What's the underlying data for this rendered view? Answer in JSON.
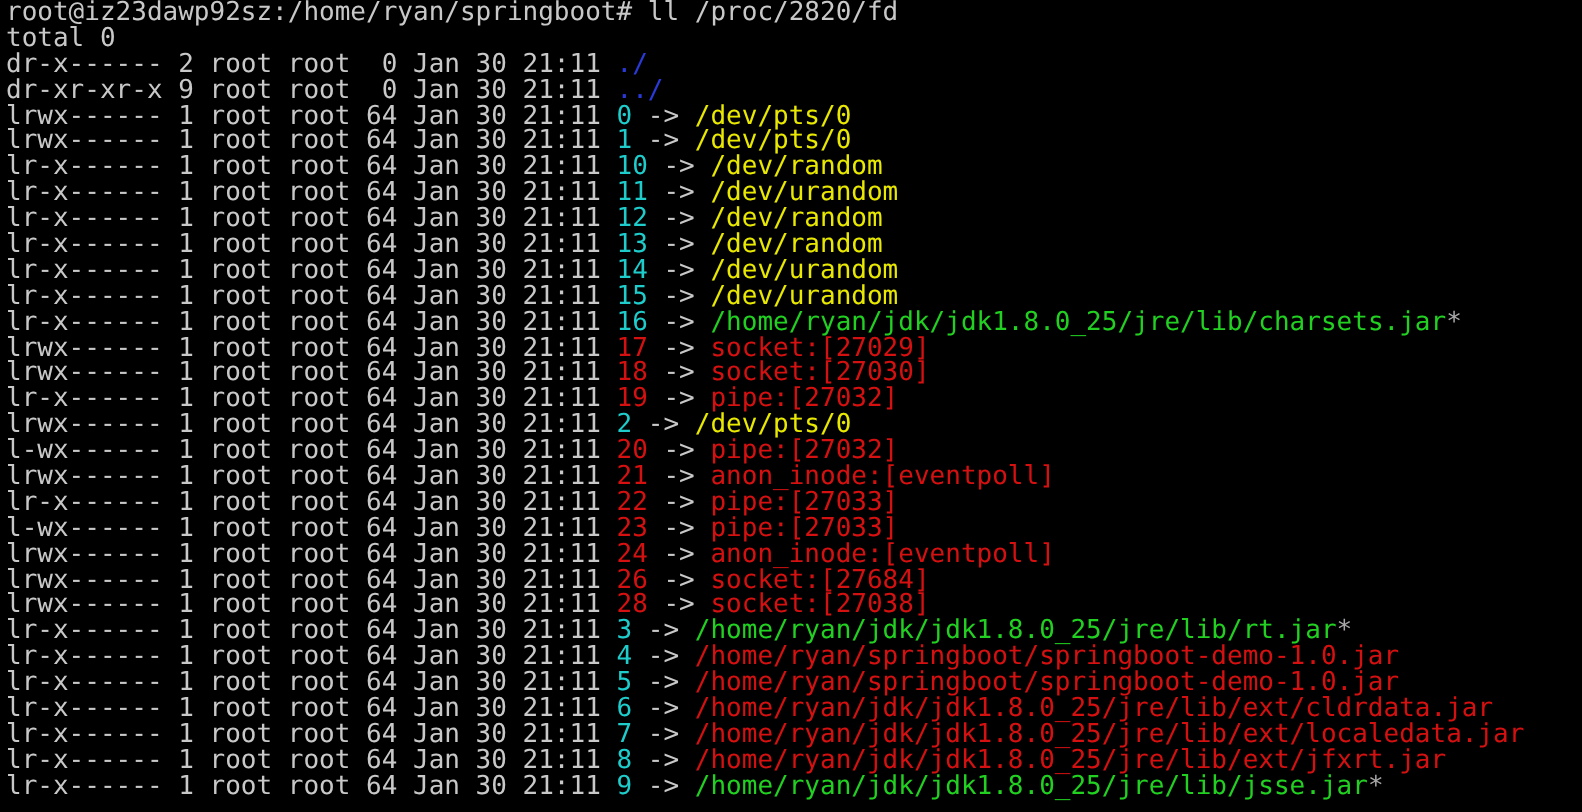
{
  "prompt": {
    "text": "root@iz23dawp92sz:/home/ryan/springboot#",
    "command": "ll /proc/2820/fd"
  },
  "total": "total 0",
  "entries": [
    {
      "meta": "dr-x------ 2 root root  0 Jan 30 21:11",
      "name": {
        "text": "./",
        "color": "#2a3ad8"
      }
    },
    {
      "meta": "dr-xr-xr-x 9 root root  0 Jan 30 21:11",
      "name": {
        "text": "../",
        "color": "#2a3ad8"
      }
    },
    {
      "meta": "lrwx------ 1 root root 64 Jan 30 21:11",
      "name": {
        "text": "0",
        "color": "#1ecccc"
      },
      "arrow": "->",
      "target": {
        "text": "/dev/pts/0",
        "color": "#e8e800"
      }
    },
    {
      "meta": "lrwx------ 1 root root 64 Jan 30 21:11",
      "name": {
        "text": "1",
        "color": "#1ecccc"
      },
      "arrow": "->",
      "target": {
        "text": "/dev/pts/0",
        "color": "#e8e800"
      }
    },
    {
      "meta": "lr-x------ 1 root root 64 Jan 30 21:11",
      "name": {
        "text": "10",
        "color": "#1ecccc"
      },
      "arrow": "->",
      "target": {
        "text": "/dev/random",
        "color": "#e8e800"
      }
    },
    {
      "meta": "lr-x------ 1 root root 64 Jan 30 21:11",
      "name": {
        "text": "11",
        "color": "#1ecccc"
      },
      "arrow": "->",
      "target": {
        "text": "/dev/urandom",
        "color": "#e8e800"
      }
    },
    {
      "meta": "lr-x------ 1 root root 64 Jan 30 21:11",
      "name": {
        "text": "12",
        "color": "#1ecccc"
      },
      "arrow": "->",
      "target": {
        "text": "/dev/random",
        "color": "#e8e800"
      }
    },
    {
      "meta": "lr-x------ 1 root root 64 Jan 30 21:11",
      "name": {
        "text": "13",
        "color": "#1ecccc"
      },
      "arrow": "->",
      "target": {
        "text": "/dev/random",
        "color": "#e8e800"
      }
    },
    {
      "meta": "lr-x------ 1 root root 64 Jan 30 21:11",
      "name": {
        "text": "14",
        "color": "#1ecccc"
      },
      "arrow": "->",
      "target": {
        "text": "/dev/urandom",
        "color": "#e8e800"
      }
    },
    {
      "meta": "lr-x------ 1 root root 64 Jan 30 21:11",
      "name": {
        "text": "15",
        "color": "#1ecccc"
      },
      "arrow": "->",
      "target": {
        "text": "/dev/urandom",
        "color": "#e8e800"
      }
    },
    {
      "meta": "lr-x------ 1 root root 64 Jan 30 21:11",
      "name": {
        "text": "16",
        "color": "#1ecccc"
      },
      "arrow": "->",
      "target": {
        "text": "/home/ryan/jdk/jdk1.8.0_25/jre/lib/charsets.jar",
        "color": "#22d022"
      },
      "suffix": "*"
    },
    {
      "meta": "lrwx------ 1 root root 64 Jan 30 21:11",
      "name": {
        "text": "17",
        "color": "#d41010"
      },
      "arrow": "->",
      "target": {
        "text": "socket:[27029]",
        "color": "#d41010"
      }
    },
    {
      "meta": "lrwx------ 1 root root 64 Jan 30 21:11",
      "name": {
        "text": "18",
        "color": "#d41010"
      },
      "arrow": "->",
      "target": {
        "text": "socket:[27030]",
        "color": "#d41010"
      }
    },
    {
      "meta": "lr-x------ 1 root root 64 Jan 30 21:11",
      "name": {
        "text": "19",
        "color": "#d41010"
      },
      "arrow": "->",
      "target": {
        "text": "pipe:[27032]",
        "color": "#d41010"
      }
    },
    {
      "meta": "lrwx------ 1 root root 64 Jan 30 21:11",
      "name": {
        "text": "2",
        "color": "#1ecccc"
      },
      "arrow": "->",
      "target": {
        "text": "/dev/pts/0",
        "color": "#e8e800"
      }
    },
    {
      "meta": "l-wx------ 1 root root 64 Jan 30 21:11",
      "name": {
        "text": "20",
        "color": "#d41010"
      },
      "arrow": "->",
      "target": {
        "text": "pipe:[27032]",
        "color": "#d41010"
      }
    },
    {
      "meta": "lrwx------ 1 root root 64 Jan 30 21:11",
      "name": {
        "text": "21",
        "color": "#d41010"
      },
      "arrow": "->",
      "target": {
        "text": "anon_inode:[eventpoll]",
        "color": "#d41010"
      }
    },
    {
      "meta": "lr-x------ 1 root root 64 Jan 30 21:11",
      "name": {
        "text": "22",
        "color": "#d41010"
      },
      "arrow": "->",
      "target": {
        "text": "pipe:[27033]",
        "color": "#d41010"
      }
    },
    {
      "meta": "l-wx------ 1 root root 64 Jan 30 21:11",
      "name": {
        "text": "23",
        "color": "#d41010"
      },
      "arrow": "->",
      "target": {
        "text": "pipe:[27033]",
        "color": "#d41010"
      }
    },
    {
      "meta": "lrwx------ 1 root root 64 Jan 30 21:11",
      "name": {
        "text": "24",
        "color": "#d41010"
      },
      "arrow": "->",
      "target": {
        "text": "anon_inode:[eventpoll]",
        "color": "#d41010"
      }
    },
    {
      "meta": "lrwx------ 1 root root 64 Jan 30 21:11",
      "name": {
        "text": "26",
        "color": "#d41010"
      },
      "arrow": "->",
      "target": {
        "text": "socket:[27684]",
        "color": "#d41010"
      }
    },
    {
      "meta": "lrwx------ 1 root root 64 Jan 30 21:11",
      "name": {
        "text": "28",
        "color": "#d41010"
      },
      "arrow": "->",
      "target": {
        "text": "socket:[27038]",
        "color": "#d41010"
      }
    },
    {
      "meta": "lr-x------ 1 root root 64 Jan 30 21:11",
      "name": {
        "text": "3",
        "color": "#1ecccc"
      },
      "arrow": "->",
      "target": {
        "text": "/home/ryan/jdk/jdk1.8.0_25/jre/lib/rt.jar",
        "color": "#22d022"
      },
      "suffix": "*"
    },
    {
      "meta": "lr-x------ 1 root root 64 Jan 30 21:11",
      "name": {
        "text": "4",
        "color": "#1ecccc"
      },
      "arrow": "->",
      "target": {
        "text": "/home/ryan/springboot/springboot-demo-1.0.jar",
        "color": "#d41010"
      }
    },
    {
      "meta": "lr-x------ 1 root root 64 Jan 30 21:11",
      "name": {
        "text": "5",
        "color": "#1ecccc"
      },
      "arrow": "->",
      "target": {
        "text": "/home/ryan/springboot/springboot-demo-1.0.jar",
        "color": "#d41010"
      }
    },
    {
      "meta": "lr-x------ 1 root root 64 Jan 30 21:11",
      "name": {
        "text": "6",
        "color": "#1ecccc"
      },
      "arrow": "->",
      "target": {
        "text": "/home/ryan/jdk/jdk1.8.0_25/jre/lib/ext/cldrdata.jar",
        "color": "#d41010"
      }
    },
    {
      "meta": "lr-x------ 1 root root 64 Jan 30 21:11",
      "name": {
        "text": "7",
        "color": "#1ecccc"
      },
      "arrow": "->",
      "target": {
        "text": "/home/ryan/jdk/jdk1.8.0_25/jre/lib/ext/localedata.jar",
        "color": "#d41010"
      }
    },
    {
      "meta": "lr-x------ 1 root root 64 Jan 30 21:11",
      "name": {
        "text": "8",
        "color": "#1ecccc"
      },
      "arrow": "->",
      "target": {
        "text": "/home/ryan/jdk/jdk1.8.0_25/jre/lib/ext/jfxrt.jar",
        "color": "#d41010"
      }
    },
    {
      "meta": "lr-x------ 1 root root 64 Jan 30 21:11",
      "name": {
        "text": "9",
        "color": "#1ecccc"
      },
      "arrow": "->",
      "target": {
        "text": "/home/ryan/jdk/jdk1.8.0_25/jre/lib/jsse.jar",
        "color": "#22d022"
      },
      "suffix": "*"
    }
  ]
}
